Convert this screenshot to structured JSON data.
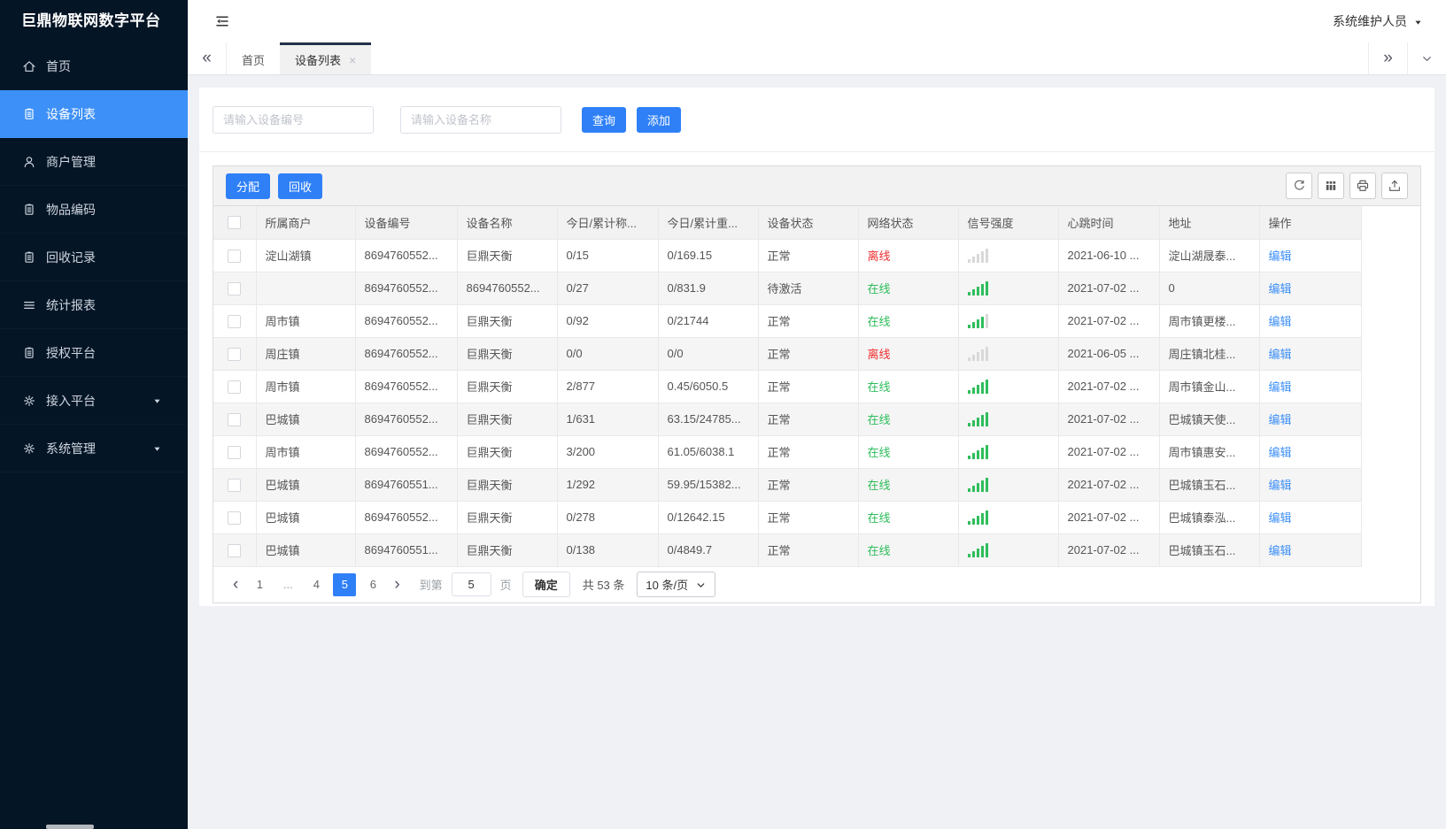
{
  "app": {
    "title": "巨鼎物联网数字平台",
    "user_name": "系统维护人员"
  },
  "sidebar": {
    "items": [
      {
        "label": "首页",
        "icon": "home-icon",
        "active": false,
        "caret": false
      },
      {
        "label": "设备列表",
        "icon": "device-list-icon",
        "active": true,
        "caret": false
      },
      {
        "label": "商户管理",
        "icon": "merchant-icon",
        "active": false,
        "caret": false
      },
      {
        "label": "物品编码",
        "icon": "item-code-icon",
        "active": false,
        "caret": false
      },
      {
        "label": "回收记录",
        "icon": "recycle-record-icon",
        "active": false,
        "caret": false
      },
      {
        "label": "统计报表",
        "icon": "report-icon",
        "active": false,
        "caret": false
      },
      {
        "label": "授权平台",
        "icon": "auth-platform-icon",
        "active": false,
        "caret": false
      },
      {
        "label": "接入平台",
        "icon": "access-platform-icon",
        "active": false,
        "caret": true
      },
      {
        "label": "系统管理",
        "icon": "system-icon",
        "active": false,
        "caret": true
      }
    ]
  },
  "tabbar": {
    "collapse_left": "«",
    "collapse_right": "»",
    "tabs": [
      {
        "label": "首页",
        "active": false,
        "closable": false
      },
      {
        "label": "设备列表",
        "active": true,
        "closable": true,
        "close_glyph": "×"
      }
    ]
  },
  "search": {
    "device_no_placeholder": "请输入设备编号",
    "device_name_placeholder": "请输入设备名称",
    "query_label": "查询",
    "add_label": "添加"
  },
  "toolbar": {
    "assign_label": "分配",
    "recycle_label": "回收",
    "icons": [
      "refresh-icon",
      "columns-icon",
      "print-icon",
      "export-icon"
    ]
  },
  "table": {
    "headers": [
      "所属商户",
      "设备编号",
      "设备名称",
      "今日/累计称...",
      "今日/累计重...",
      "设备状态",
      "网络状态",
      "信号强度",
      "心跳时间",
      "地址",
      "操作"
    ],
    "rows": [
      {
        "merchant": "淀山湖镇",
        "device_no": "8694760552...",
        "device_name": "巨鼎天衡",
        "today_count": "0/15",
        "today_weight": "0/169.15",
        "device_status": "正常",
        "network_status": "离线",
        "online": false,
        "signal": 0,
        "heartbeat": "2021-06-10 ...",
        "address": "淀山湖晟泰...",
        "action": "编辑"
      },
      {
        "merchant": "",
        "device_no": "8694760552...",
        "device_name": "8694760552...",
        "today_count": "0/27",
        "today_weight": "0/831.9",
        "device_status": "待激活",
        "network_status": "在线",
        "online": true,
        "signal": 5,
        "heartbeat": "2021-07-02 ...",
        "address": "0",
        "action": "编辑"
      },
      {
        "merchant": "周市镇",
        "device_no": "8694760552...",
        "device_name": "巨鼎天衡",
        "today_count": "0/92",
        "today_weight": "0/21744",
        "device_status": "正常",
        "network_status": "在线",
        "online": true,
        "signal": 4,
        "heartbeat": "2021-07-02 ...",
        "address": "周市镇更楼...",
        "action": "编辑"
      },
      {
        "merchant": "周庄镇",
        "device_no": "8694760552...",
        "device_name": "巨鼎天衡",
        "today_count": "0/0",
        "today_weight": "0/0",
        "device_status": "正常",
        "network_status": "离线",
        "online": false,
        "signal": 0,
        "heartbeat": "2021-06-05 ...",
        "address": "周庄镇北桂...",
        "action": "编辑"
      },
      {
        "merchant": "周市镇",
        "device_no": "8694760552...",
        "device_name": "巨鼎天衡",
        "today_count": "2/877",
        "today_weight": "0.45/6050.5",
        "device_status": "正常",
        "network_status": "在线",
        "online": true,
        "signal": 5,
        "heartbeat": "2021-07-02 ...",
        "address": "周市镇金山...",
        "action": "编辑"
      },
      {
        "merchant": "巴城镇",
        "device_no": "8694760552...",
        "device_name": "巨鼎天衡",
        "today_count": "1/631",
        "today_weight": "63.15/24785...",
        "device_status": "正常",
        "network_status": "在线",
        "online": true,
        "signal": 5,
        "heartbeat": "2021-07-02 ...",
        "address": "巴城镇天使...",
        "action": "编辑"
      },
      {
        "merchant": "周市镇",
        "device_no": "8694760552...",
        "device_name": "巨鼎天衡",
        "today_count": "3/200",
        "today_weight": "61.05/6038.1",
        "device_status": "正常",
        "network_status": "在线",
        "online": true,
        "signal": 5,
        "heartbeat": "2021-07-02 ...",
        "address": "周市镇惠安...",
        "action": "编辑"
      },
      {
        "merchant": "巴城镇",
        "device_no": "8694760551...",
        "device_name": "巨鼎天衡",
        "today_count": "1/292",
        "today_weight": "59.95/15382...",
        "device_status": "正常",
        "network_status": "在线",
        "online": true,
        "signal": 5,
        "heartbeat": "2021-07-02 ...",
        "address": "巴城镇玉石...",
        "action": "编辑"
      },
      {
        "merchant": "巴城镇",
        "device_no": "8694760552...",
        "device_name": "巨鼎天衡",
        "today_count": "0/278",
        "today_weight": "0/12642.15",
        "device_status": "正常",
        "network_status": "在线",
        "online": true,
        "signal": 5,
        "heartbeat": "2021-07-02 ...",
        "address": "巴城镇泰泓...",
        "action": "编辑"
      },
      {
        "merchant": "巴城镇",
        "device_no": "8694760551...",
        "device_name": "巨鼎天衡",
        "today_count": "0/138",
        "today_weight": "0/4849.7",
        "device_status": "正常",
        "network_status": "在线",
        "online": true,
        "signal": 5,
        "heartbeat": "2021-07-02 ...",
        "address": "巴城镇玉石...",
        "action": "编辑"
      }
    ]
  },
  "pagination": {
    "prev_glyph": "‹",
    "next_glyph": "›",
    "pages": [
      "1",
      "...",
      "4",
      "5",
      "6"
    ],
    "active_page": "5",
    "goto_label": "到第",
    "goto_value": "5",
    "page_unit_label": "页",
    "confirm_label": "确定",
    "total_label": "共 53 条",
    "page_size_label": "10 条/页"
  },
  "colors": {
    "sidebar_bg": "#041526",
    "accent_blue": "#2F80F7",
    "sidebar_active": "#3D90F7",
    "online_green": "#2EBD5B",
    "offline_red": "#EE2F2F",
    "link_blue": "#3D8FF7",
    "tab_active_border": "#22304A"
  }
}
